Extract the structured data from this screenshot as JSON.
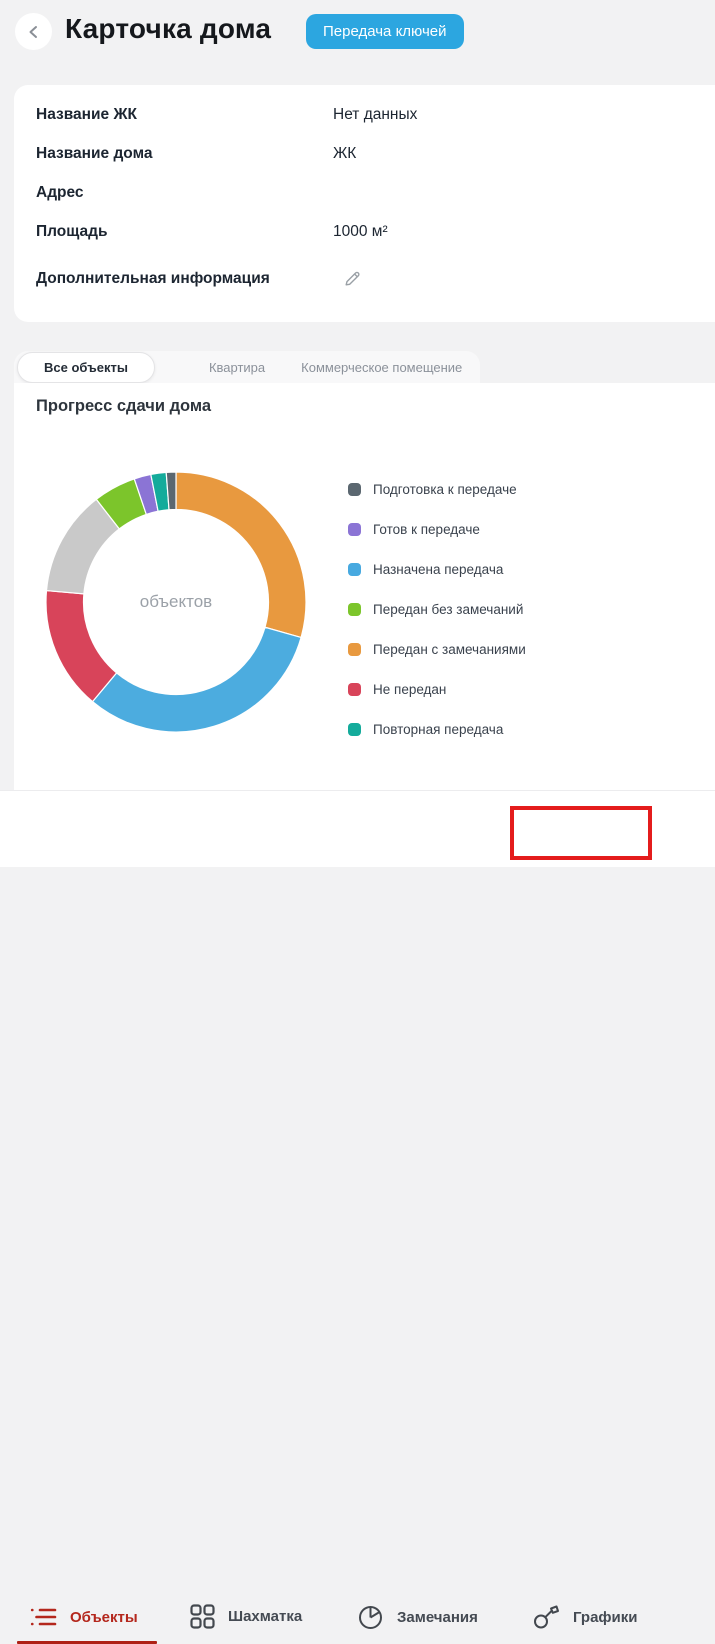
{
  "header": {
    "title": "Карточка дома",
    "action_button": "Передача ключей",
    "accent_blue": "#2ca6e0"
  },
  "info_card": {
    "fields": [
      {
        "label": "Название ЖК",
        "value": "Нет данных",
        "editable": false
      },
      {
        "label": "Название дома",
        "value": "ЖК",
        "editable": false
      },
      {
        "label": "Адрес",
        "value": "",
        "editable": false
      },
      {
        "label": "Площадь",
        "value": "1000 м²",
        "editable": false
      },
      {
        "label": "Дополнительная информация",
        "value": "",
        "editable": true
      }
    ]
  },
  "tabs": [
    {
      "label": "Все объекты",
      "active": true
    },
    {
      "label": "Квартира",
      "active": false
    },
    {
      "label": "Коммерческое помещение",
      "active": false
    }
  ],
  "chart_section": {
    "title": "Прогресс сдачи дома"
  },
  "chart_data": {
    "type": "donut",
    "center_label": "объектов",
    "legend_position": "right",
    "legend": [
      {
        "label": "Подготовка к передаче",
        "color": "#5b6770"
      },
      {
        "label": "Готов к передаче",
        "color": "#8b74d5"
      },
      {
        "label": "Назначена передача",
        "color": "#47a9e0"
      },
      {
        "label": "Передан без замечаний",
        "color": "#7cc52b"
      },
      {
        "label": "Передан с замечаниями",
        "color": "#e8993f"
      },
      {
        "label": "Не передан",
        "color": "#d8445a"
      },
      {
        "label": "Повторная передача",
        "color": "#14ab9b"
      }
    ],
    "segments_clockwise_from_top": [
      {
        "label": "Передан с замечаниями",
        "color": "#e8993f",
        "percent": 29.4
      },
      {
        "label": "Назначена передача",
        "color": "#4cacdf",
        "percent": 31.7
      },
      {
        "label": "Не передан",
        "color": "#d8445a",
        "percent": 15.3
      },
      {
        "label": "",
        "color": "#c9c9c9",
        "percent": 13.1
      },
      {
        "label": "Передан без замечаний",
        "color": "#7cc52b",
        "percent": 5.3
      },
      {
        "label": "Готов к передаче",
        "color": "#8b74d5",
        "percent": 2.1
      },
      {
        "label": "Повторная передача",
        "color": "#14ab9b",
        "percent": 1.9
      },
      {
        "label": "Подготовка к передаче",
        "color": "#5b6770",
        "percent": 1.2
      }
    ]
  },
  "bottom_nav": {
    "items": [
      {
        "label": "Объекты",
        "icon": "list-icon",
        "active": true,
        "highlighted": false
      },
      {
        "label": "Шахматка",
        "icon": "grid-icon",
        "active": false,
        "highlighted": false
      },
      {
        "label": "Замечания",
        "icon": "pie-icon",
        "active": false,
        "highlighted": false
      },
      {
        "label": "Графики",
        "icon": "key-icon",
        "active": false,
        "highlighted": true
      }
    ],
    "active_color": "#b4271c"
  },
  "annotation": {
    "type": "highlight-rect",
    "target": "Графики",
    "color": "#e41c1c"
  }
}
